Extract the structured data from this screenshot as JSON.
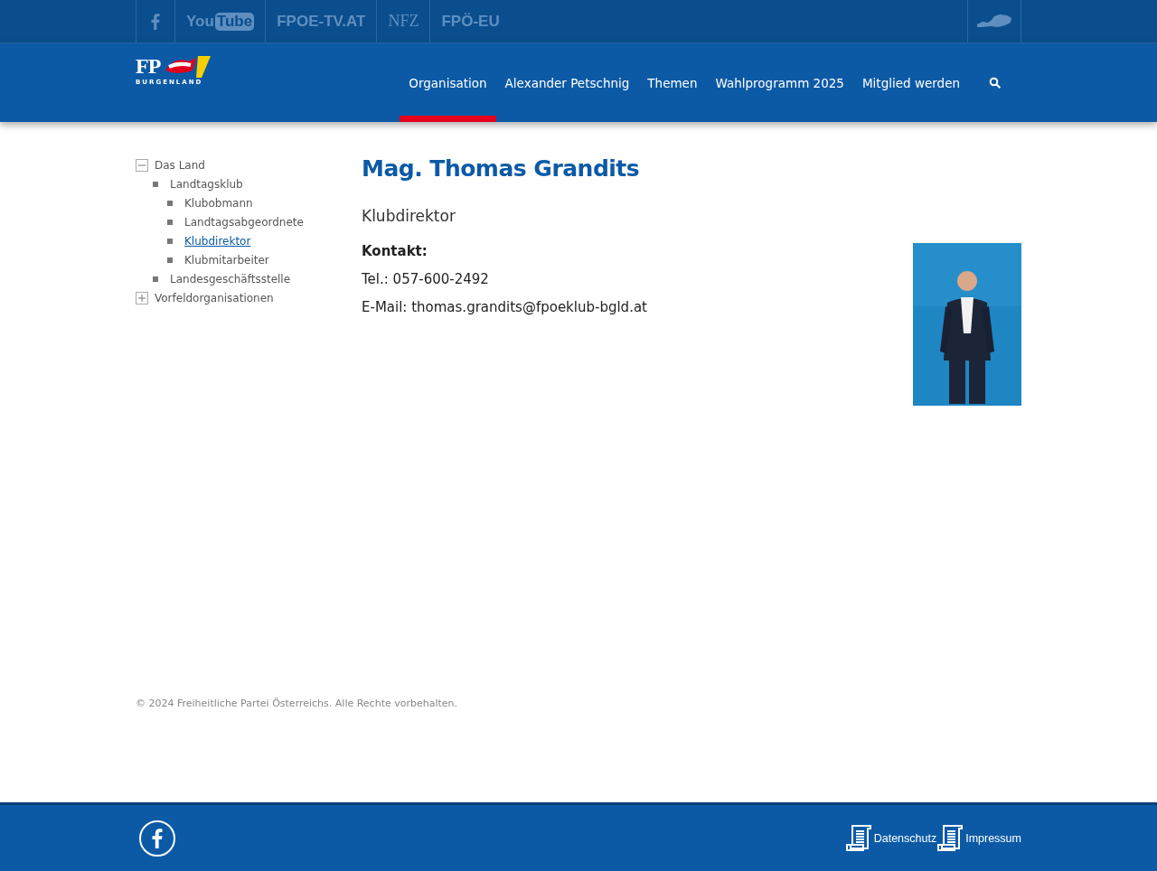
{
  "top_links": [
    {
      "kind": "facebook"
    },
    {
      "kind": "text",
      "label": "You",
      "badge": "Tube"
    },
    {
      "kind": "text",
      "label": "FPOE-TV.AT"
    },
    {
      "kind": "serif",
      "label": "NFZ"
    },
    {
      "kind": "text",
      "label": "FPÖ-EU"
    }
  ],
  "logo": {
    "letters": "FP",
    "region": "BURGENLAND"
  },
  "nav": [
    {
      "label": "Organisation",
      "selected": true
    },
    {
      "label": "Alexander Petschnig",
      "selected": false
    },
    {
      "label": "Themen",
      "selected": false
    },
    {
      "label": "Wahlprogramm 2025",
      "selected": false
    },
    {
      "label": "Mitglied werden",
      "selected": false
    }
  ],
  "sidebar": {
    "items": [
      {
        "label": "Das Land",
        "expanded": true,
        "selected": false,
        "children": [
          {
            "label": "Landtagsklub",
            "selected": false,
            "children": [
              {
                "label": "Klubobmann",
                "selected": false
              },
              {
                "label": "Landtagsabgeordnete",
                "selected": false
              },
              {
                "label": "Klubdirektor",
                "selected": true
              },
              {
                "label": "Klubmitarbeiter",
                "selected": false
              }
            ]
          },
          {
            "label": "Landesgeschäftsstelle",
            "selected": false
          }
        ]
      },
      {
        "label": "Vorfeldorganisationen",
        "expanded": false,
        "selected": false
      }
    ]
  },
  "person": {
    "name": "Mag. Thomas Grandits",
    "role": "Klubdirektor",
    "contact_heading": "Kontakt:",
    "phone": "Tel.: 057-600-2492",
    "email": "E-Mail: thomas.grandits@fpoeklub-bgld.at"
  },
  "copyright": "© 2024 Freiheitliche Partei Österreichs. Alle Rechte vorbehalten.",
  "footer_links": [
    "Datenschutz",
    "Impressum"
  ]
}
